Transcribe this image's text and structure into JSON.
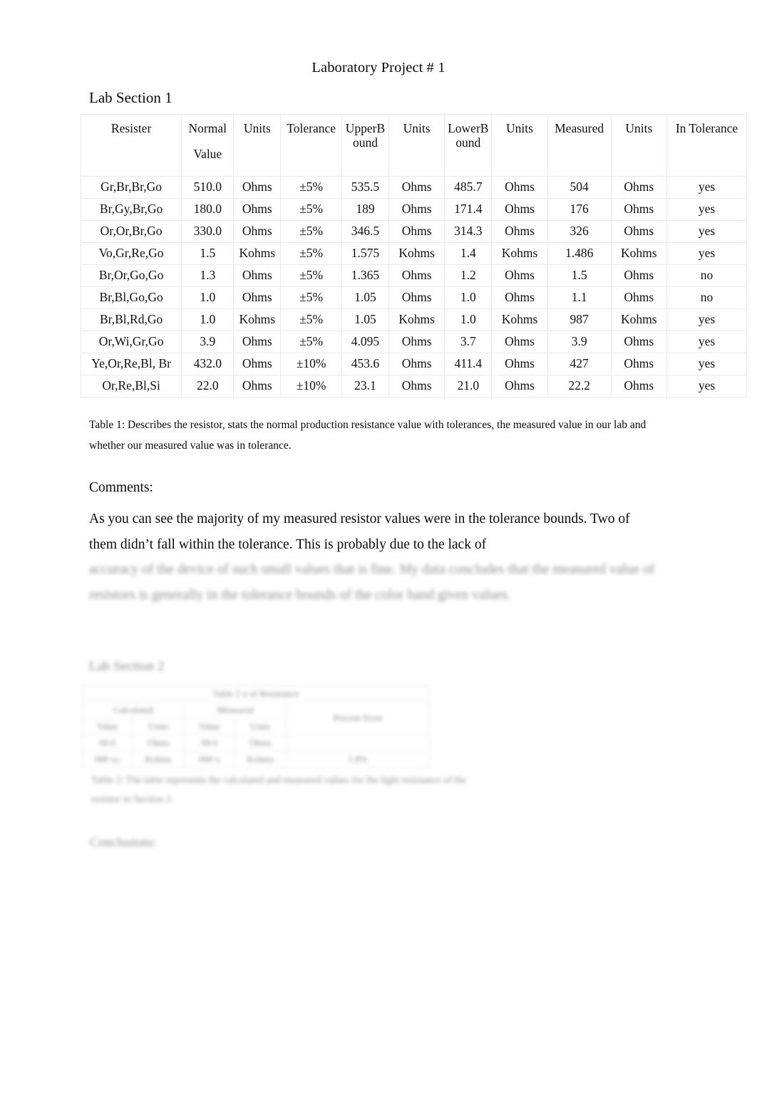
{
  "document": {
    "title": "Laboratory Project # 1",
    "section_heading": "Lab Section 1"
  },
  "table1": {
    "headers": [
      {
        "line1": "Resister",
        "line2": ""
      },
      {
        "line1": "Normal",
        "line2": "Value"
      },
      {
        "line1": "Units",
        "line2": ""
      },
      {
        "line1": "Tolerance",
        "line2": ""
      },
      {
        "line1": "Upper",
        "line2": "Bound"
      },
      {
        "line1": "Units",
        "line2": ""
      },
      {
        "line1": "Lower",
        "line2": "Bound"
      },
      {
        "line1": "Units",
        "line2": ""
      },
      {
        "line1": "Measured",
        "line2": ""
      },
      {
        "line1": "Units",
        "line2": ""
      },
      {
        "line1": "In Tolerance",
        "line2": ""
      }
    ],
    "rows": [
      {
        "resister": "Gr,Br,Br,Go",
        "normal_value": "510.0",
        "units1": "Ohms",
        "tolerance": "±5%",
        "upper_bound": "535.5",
        "units2": "Ohms",
        "lower_bound": "485.7",
        "units3": "Ohms",
        "measured": "504",
        "units4": "Ohms",
        "in_tolerance": "yes"
      },
      {
        "resister": "Br,Gy,Br,Go",
        "normal_value": "180.0",
        "units1": "Ohms",
        "tolerance": "±5%",
        "upper_bound": "189",
        "units2": "Ohms",
        "lower_bound": "171.4",
        "units3": "Ohms",
        "measured": "176",
        "units4": "Ohms",
        "in_tolerance": "yes"
      },
      {
        "resister": "Or,Or,Br,Go",
        "normal_value": "330.0",
        "units1": "Ohms",
        "tolerance": "±5%",
        "upper_bound": "346.5",
        "units2": "Ohms",
        "lower_bound": "314.3",
        "units3": "Ohms",
        "measured": "326",
        "units4": "Ohms",
        "in_tolerance": "yes"
      },
      {
        "resister": "Vo,Gr,Re,Go",
        "normal_value": "1.5",
        "units1": "Kohms",
        "tolerance": "±5%",
        "upper_bound": "1.575",
        "units2": "Kohms",
        "lower_bound": "1.4",
        "units3": "Kohms",
        "measured": "1.486",
        "units4": "Kohms",
        "in_tolerance": "yes"
      },
      {
        "resister": "Br,Or,Go,Go",
        "normal_value": "1.3",
        "units1": "Ohms",
        "tolerance": "±5%",
        "upper_bound": "1.365",
        "units2": "Ohms",
        "lower_bound": "1.2",
        "units3": "Ohms",
        "measured": "1.5",
        "units4": "Ohms",
        "in_tolerance": "no"
      },
      {
        "resister": "Br,Bl,Go,Go",
        "normal_value": "1.0",
        "units1": "Ohms",
        "tolerance": "±5%",
        "upper_bound": "1.05",
        "units2": "Ohms",
        "lower_bound": "1.0",
        "units3": "Ohms",
        "measured": "1.1",
        "units4": "Ohms",
        "in_tolerance": "no"
      },
      {
        "resister": "Br,Bl,Rd,Go",
        "normal_value": "1.0",
        "units1": "Kohms",
        "tolerance": "±5%",
        "upper_bound": "1.05",
        "units2": "Kohms",
        "lower_bound": "1.0",
        "units3": "Kohms",
        "measured": "987",
        "units4": "Kohms",
        "in_tolerance": "yes"
      },
      {
        "resister": "Or,Wi,Gr,Go",
        "normal_value": "3.9",
        "units1": "Ohms",
        "tolerance": "±5%",
        "upper_bound": "4.095",
        "units2": "Ohms",
        "lower_bound": "3.7",
        "units3": "Ohms",
        "measured": "3.9",
        "units4": "Ohms",
        "in_tolerance": "yes"
      },
      {
        "resister": "Ye,Or,Re,Bl, Br",
        "normal_value": "432.0",
        "units1": "Ohms",
        "tolerance": "±10%",
        "upper_bound": "453.6",
        "units2": "Ohms",
        "lower_bound": "411.4",
        "units3": "Ohms",
        "measured": "427",
        "units4": "Ohms",
        "in_tolerance": "yes"
      },
      {
        "resister": "Or,Re,Bl,Si",
        "normal_value": "22.0",
        "units1": "Ohms",
        "tolerance": "±10%",
        "upper_bound": "23.1",
        "units2": "Ohms",
        "lower_bound": "21.0",
        "units3": "Ohms",
        "measured": "22.2",
        "units4": "Ohms",
        "in_tolerance": "yes"
      }
    ],
    "caption": "Table 1: Describes the resistor, stats the normal production resistance value with tolerances, the measured value in our lab and whether our measured value was in tolerance."
  },
  "comments": {
    "label": "Comments:",
    "body": "As you can see the majority of my measured resistor values were in the tolerance bounds. Two of them didn’t fall within the tolerance. This is probably due to the lack of",
    "body_illegible": "accuracy of the device of such small values that is fine. My data concludes that the measured value of resistors is generally in the tolerance bounds of the color band given values."
  },
  "section2": {
    "heading": "Lab Section 2",
    "table": {
      "title": "Table 2 n of Resistance",
      "group_headers": [
        "Calculated",
        "Measured",
        "Percent Error"
      ],
      "sub_headers": [
        "Value",
        "Units",
        "Value",
        "Units"
      ],
      "rows": [
        [
          "00.0",
          "Ohms",
          "00.0",
          "Ohms",
          ""
        ],
        [
          "000 xx",
          "Kohms",
          "000 x",
          "Kohms",
          "1.8%"
        ]
      ]
    },
    "caption": "Table 2: The table represents the calculated and measured values for the light resistance of the resistor in Section 2.",
    "conclusions_label": "Conclusions:"
  }
}
